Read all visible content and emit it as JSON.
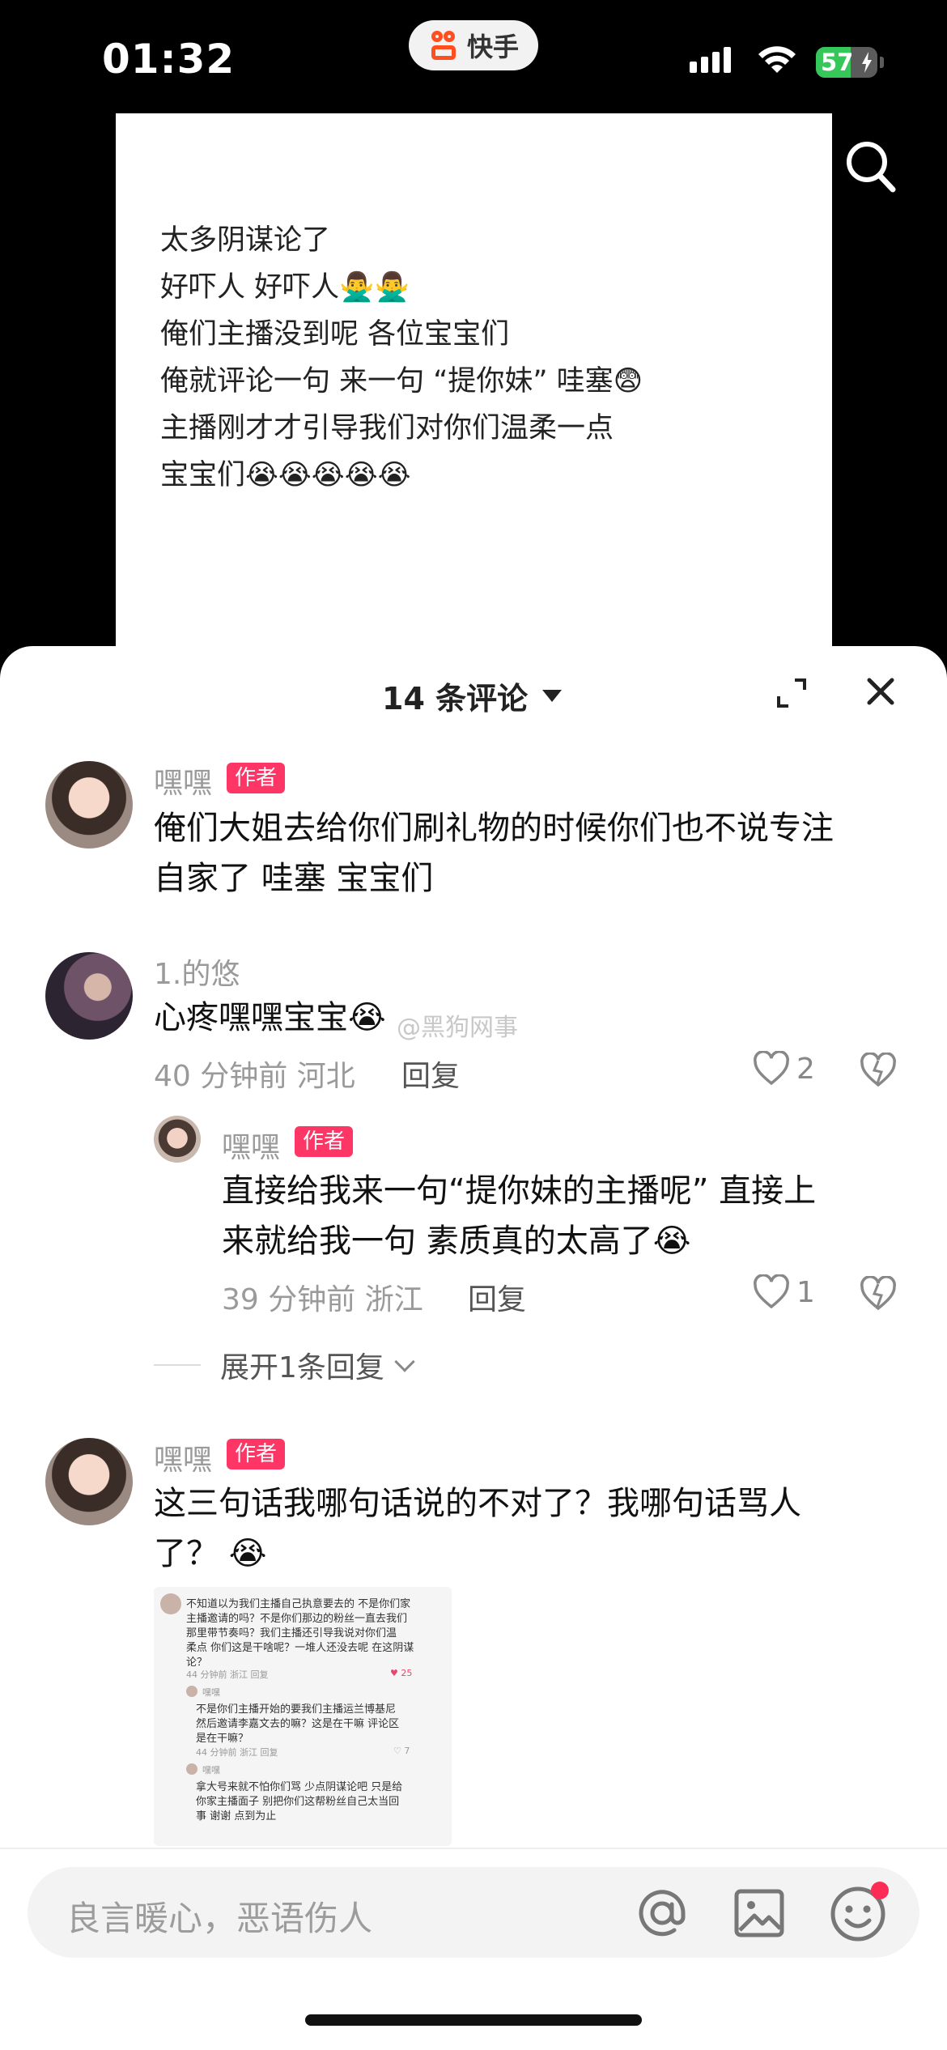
{
  "status_bar": {
    "time": "01:32",
    "app_name": "快手",
    "battery": "57"
  },
  "video": {
    "lines": [
      "太多阴谋论了",
      "好吓人 好吓人🙅‍♂️🙅‍♂️",
      "俺们主播没到呢 各位宝宝们",
      "俺就评论一句 来一句 “提你妹” 哇塞😨",
      "主播刚才才引导我们对你们温柔一点",
      "宝宝们😭😭😭😭😭"
    ]
  },
  "comments_header": {
    "title": "14 条评论"
  },
  "comments": [
    {
      "user": "嘿嘿",
      "tag": "作者",
      "lines": [
        "俺们大姐去给你们刷礼物的时候你们也不说专注",
        "自家了 哇塞 宝宝们"
      ]
    },
    {
      "user": "1.的悠",
      "lines": [
        "心疼嘿嘿宝宝😭"
      ],
      "time_location": "40 分钟前 河北",
      "reply_label": "回复",
      "likes": "2",
      "watermark": "@黑狗网事"
    },
    {
      "user": "嘿嘿",
      "tag": "作者",
      "lines": [
        "直接给我来一句“提你妹的主播呢” 直接上",
        "来就给我一句 素质真的太高了😭"
      ],
      "time_location": "39 分钟前 浙江",
      "reply_label": "回复",
      "likes": "1"
    },
    {
      "user": "嘿嘿",
      "tag": "作者",
      "lines": [
        "这三句话我哪句话说的不对了？我哪句话骂人",
        "了？ 😭"
      ]
    }
  ],
  "expand_replies": "展开1条回复",
  "thumbnail": {
    "lines": [
      "不知道以为我们主播自己执意要去的 不是你们家",
      "主播邀请的吗？不是你们那边的粉丝一直去我们",
      "那里带节奏吗？我们主播还引导我说对你们温",
      "柔点 你们这是干啥呢？一堆人还没去呢 在这阴谋",
      "论？",
      "44 分钟前 浙江    回复",
      "25",
      "嘿嘿",
      "不是你们主播开始的要我们主播运兰博基尼",
      "然后邀请李嘉文去的嘛？这是在干嘛 评论区",
      "是在干嘛？",
      "44 分钟前 浙江    回复",
      "7",
      "嘿嘿",
      "拿大号来就不怕你们骂 少点阴谋论吧 只是给",
      "你家主播面子 别把你们这帮粉丝自己太当回",
      "事 谢谢 点到为止"
    ]
  },
  "input": {
    "placeholder": "良言暖心，恶语伤人"
  },
  "colors": {
    "tag_bg": "#fe3666",
    "battery_green": "#35c759",
    "brand_orange": "#ff4f1f"
  }
}
